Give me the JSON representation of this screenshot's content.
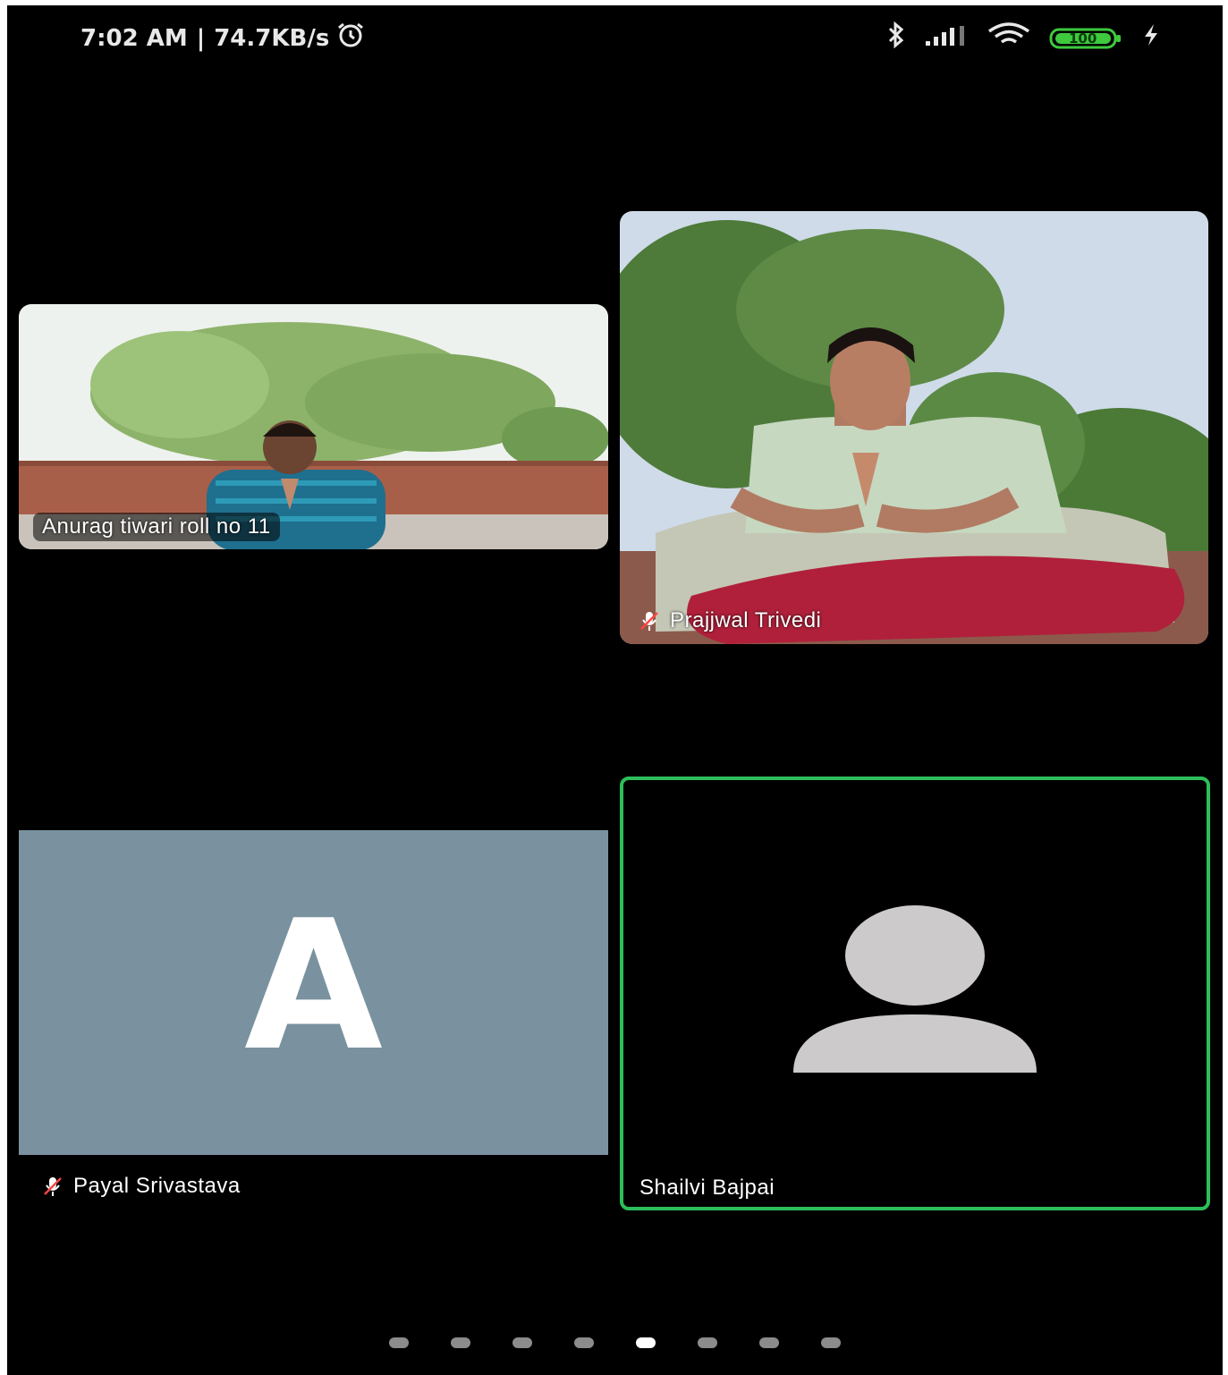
{
  "status_bar": {
    "time": "7:02 AM",
    "separator": "|",
    "network_speed": "74.7KB/s",
    "battery_level": "100",
    "icons": [
      "alarm-icon",
      "bluetooth-icon",
      "signal-icon",
      "wifi-icon",
      "battery-icon",
      "charging-icon"
    ]
  },
  "participants": [
    {
      "name": "Anurag tiwari roll no 11",
      "video": true,
      "muted": false
    },
    {
      "name": "Prajjwal Trivedi",
      "video": true,
      "muted": true
    },
    {
      "name": "Payal Srivastava",
      "video": false,
      "muted": true,
      "avatar_letter": "A",
      "avatar_color": "#7a929f"
    },
    {
      "name": "Shailvi Bajpai",
      "video": false,
      "muted": false,
      "active_speaker": true,
      "highlight_color": "#2dbe5a"
    }
  ],
  "pagination": {
    "total_pages": 8,
    "current_page": 5
  }
}
